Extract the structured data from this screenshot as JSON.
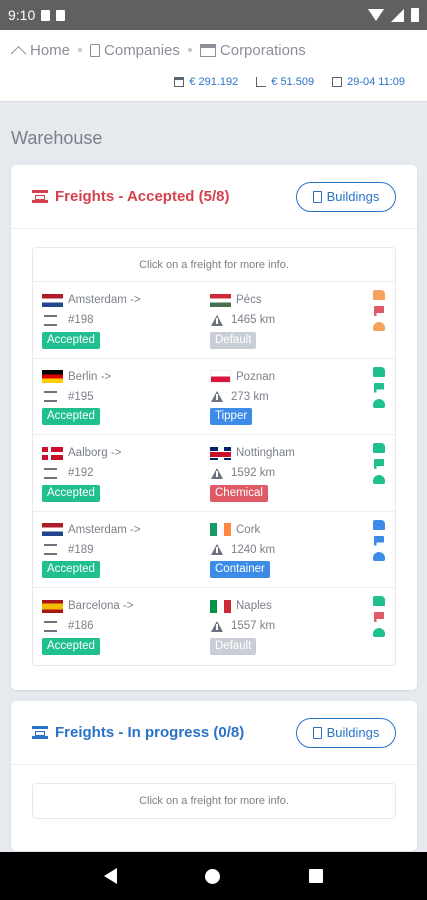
{
  "statusbar": {
    "time": "9:10"
  },
  "breadcrumb": {
    "home": "Home",
    "companies": "Companies",
    "corporations": "Corporations"
  },
  "stats": {
    "balance": "€ 291.192",
    "income": "€ 51.509",
    "datetime": "29-04 11:09"
  },
  "page": {
    "title": "Warehouse"
  },
  "accepted": {
    "title": "Freights - Accepted (5/8)",
    "buildings_label": "Buildings",
    "hint": "Click on a freight for more info.",
    "rows": [
      {
        "from": "Amsterdam ->",
        "from_flag": "nl",
        "id": "#198",
        "status": "Accepted",
        "to": "Pécs",
        "to_flag": "hu",
        "distance": "1465 km",
        "type": "Default",
        "type_class": "default",
        "icon_color": "orange"
      },
      {
        "from": "Berlin ->",
        "from_flag": "de",
        "id": "#195",
        "status": "Accepted",
        "to": "Poznan",
        "to_flag": "pl",
        "distance": "273 km",
        "type": "Tipper",
        "type_class": "tipper",
        "icon_color": "green"
      },
      {
        "from": "Aalborg ->",
        "from_flag": "dk",
        "id": "#192",
        "status": "Accepted",
        "to": "Nottingham",
        "to_flag": "gb",
        "distance": "1592 km",
        "type": "Chemical",
        "type_class": "chemical",
        "icon_color": "green"
      },
      {
        "from": "Amsterdam ->",
        "from_flag": "nl",
        "id": "#189",
        "status": "Accepted",
        "to": "Cork",
        "to_flag": "ie",
        "distance": "1240 km",
        "type": "Container",
        "type_class": "container",
        "icon_color": "blue"
      },
      {
        "from": "Barcelona ->",
        "from_flag": "es",
        "id": "#186",
        "status": "Accepted",
        "to": "Naples",
        "to_flag": "it",
        "distance": "1557 km",
        "type": "Default",
        "type_class": "default",
        "icon_color": "green"
      }
    ]
  },
  "in_progress": {
    "title": "Freights - In progress (0/8)",
    "buildings_label": "Buildings",
    "hint": "Click on a freight for more info."
  },
  "colors": {
    "accent_blue": "#2a72c7",
    "accent_red": "#d4414c",
    "badge_green": "#1fbf8f"
  }
}
